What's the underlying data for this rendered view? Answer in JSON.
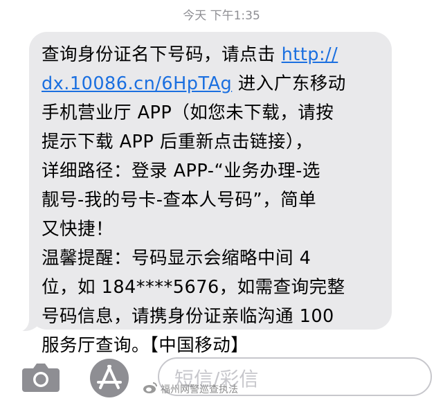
{
  "header": {
    "timestamp": "今天 下午1:35"
  },
  "message": {
    "lines": [
      {
        "before": "查询身份证名下号码，请点击 ",
        "link": "http://",
        "after": ""
      },
      {
        "before": "",
        "link": "dx.10086.cn/6HpTAg",
        "after": " 进入广东移动"
      },
      {
        "before": "手机营业厅 APP（如您未下载，请按",
        "link": "",
        "after": ""
      },
      {
        "before": "提示下载 APP 后重新点击链接），",
        "link": "",
        "after": ""
      },
      {
        "before": "详细路径：登录 APP-“业务办理-选",
        "link": "",
        "after": ""
      },
      {
        "before": "靓号-我的号卡-查本人号码”，简单",
        "link": "",
        "after": ""
      },
      {
        "before": "又快捷！",
        "link": "",
        "after": ""
      },
      {
        "before": "温馨提醒：号码显示会缩略中间 4",
        "link": "",
        "after": ""
      },
      {
        "before": "位，如 184****5676，如需查询完整",
        "link": "",
        "after": ""
      },
      {
        "before": "号码信息，请携身份证亲临沟通 100",
        "link": "",
        "after": ""
      },
      {
        "before": "服务厅查询。【中国移动】",
        "link": "",
        "after": ""
      }
    ]
  },
  "composer": {
    "placeholder": "短信/彩信",
    "camera_icon": "camera-icon",
    "appstore_icon": "appstore-icon"
  },
  "watermark": {
    "text": "福州网警巡查执法"
  },
  "colors": {
    "bubble": "#e9e9eb",
    "link": "#1a6fe0",
    "meta": "#8e8e93"
  }
}
